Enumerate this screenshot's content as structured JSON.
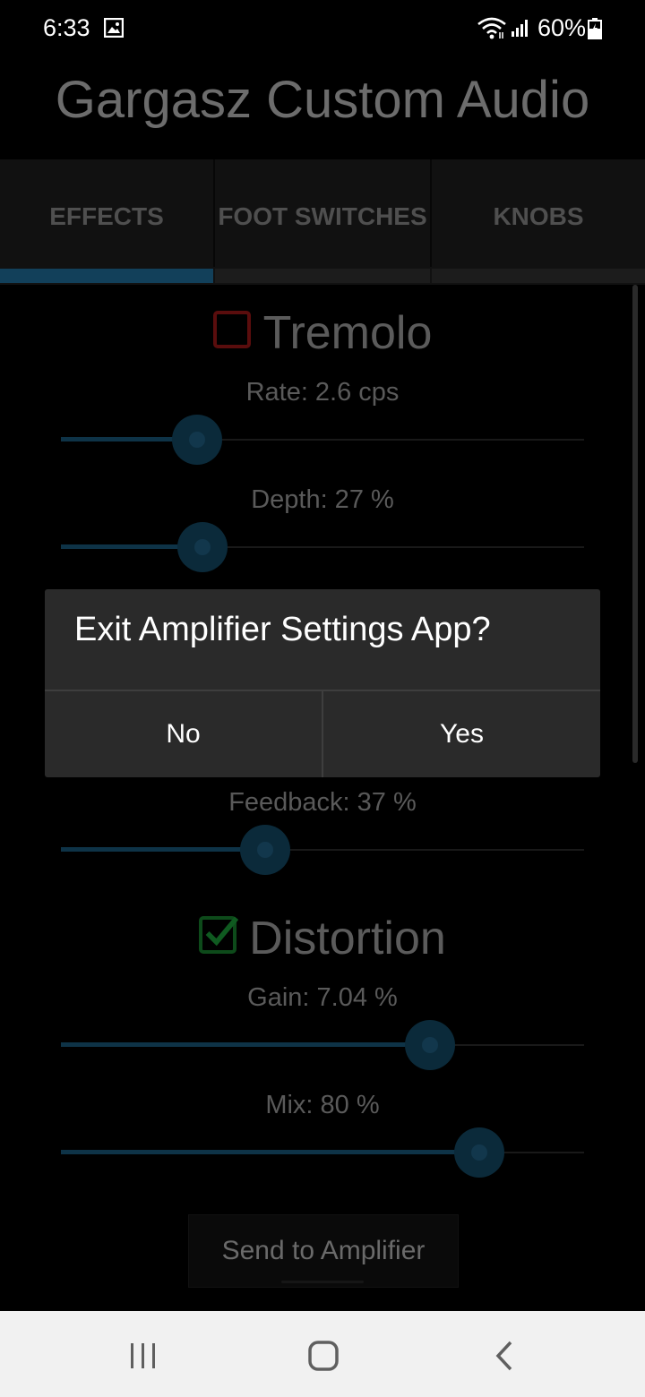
{
  "status_bar": {
    "time": "6:33",
    "battery": "60%"
  },
  "app": {
    "title": "Gargasz Custom Audio"
  },
  "tabs": [
    {
      "label": "EFFECTS",
      "selected": true
    },
    {
      "label": "FOOT SWITCHES",
      "selected": false
    },
    {
      "label": "KNOBS",
      "selected": false
    }
  ],
  "tremolo": {
    "title": "Tremolo",
    "enabled": false,
    "rate": {
      "label": "Rate: 2.6 cps",
      "level": 0.26
    },
    "depth": {
      "label": "Depth: 27 %",
      "level": 0.27
    }
  },
  "feedback": {
    "label": "Feedback: 37 %",
    "level": 0.39
  },
  "distortion": {
    "title": "Distortion",
    "enabled": true,
    "gain": {
      "label": "Gain: 7.04 %",
      "level": 0.705
    },
    "mix": {
      "label": "Mix: 80 %",
      "level": 0.8
    }
  },
  "send_button": {
    "label": "Send to Amplifier"
  },
  "dialog": {
    "title": "Exit Amplifier Settings App?",
    "no_label": "No",
    "yes_label": "Yes"
  },
  "colors": {
    "accent": "#0e3347",
    "unchecked": "#5a0d0d",
    "checked": "#0d4a1a",
    "indicator_active": "#12405a",
    "indicator_inactive": "#1c1c1c"
  },
  "icons": [
    "gallery-icon",
    "wifi-icon",
    "signal-icon",
    "battery-icon",
    "recents-icon",
    "home-icon",
    "back-icon"
  ]
}
